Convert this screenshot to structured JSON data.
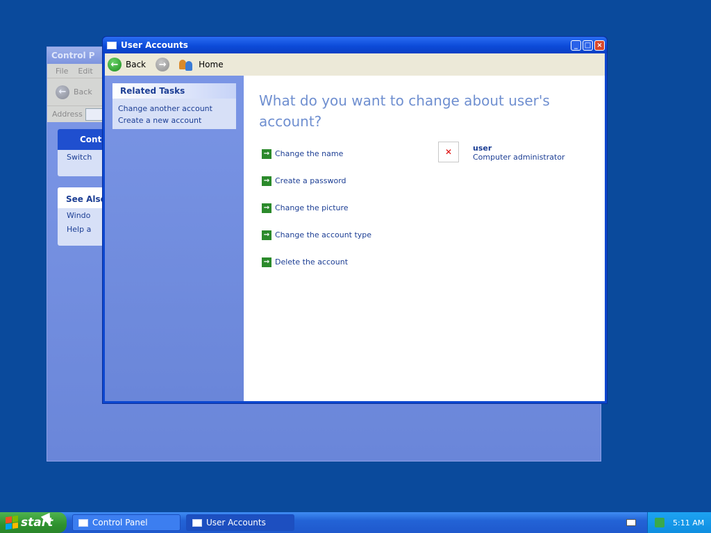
{
  "background_window": {
    "title": "Control P",
    "menu": [
      "File",
      "Edit"
    ],
    "toolbar_back": "Back",
    "address_label": "Address",
    "panel_1_title": "Contr",
    "panel_1_items": [
      "Switch"
    ],
    "panel_2_title": "See Also",
    "panel_2_items": [
      "Windo",
      "Help a"
    ]
  },
  "window": {
    "title": "User Accounts",
    "toolbar": {
      "back_label": "Back",
      "home_label": "Home"
    }
  },
  "related_tasks": {
    "title": "Related Tasks",
    "items": [
      "Change another account",
      "Create a new account"
    ]
  },
  "main": {
    "question": "What do you want to change about user's account?",
    "actions": [
      "Change the name",
      "Create a password",
      "Change the picture",
      "Change the account type",
      "Delete the account"
    ]
  },
  "user": {
    "name": "user",
    "role": "Computer administrator"
  },
  "taskbar": {
    "start_label": "start",
    "buttons": [
      "Control Panel",
      "User Accounts"
    ],
    "clock": "5:11 AM"
  }
}
